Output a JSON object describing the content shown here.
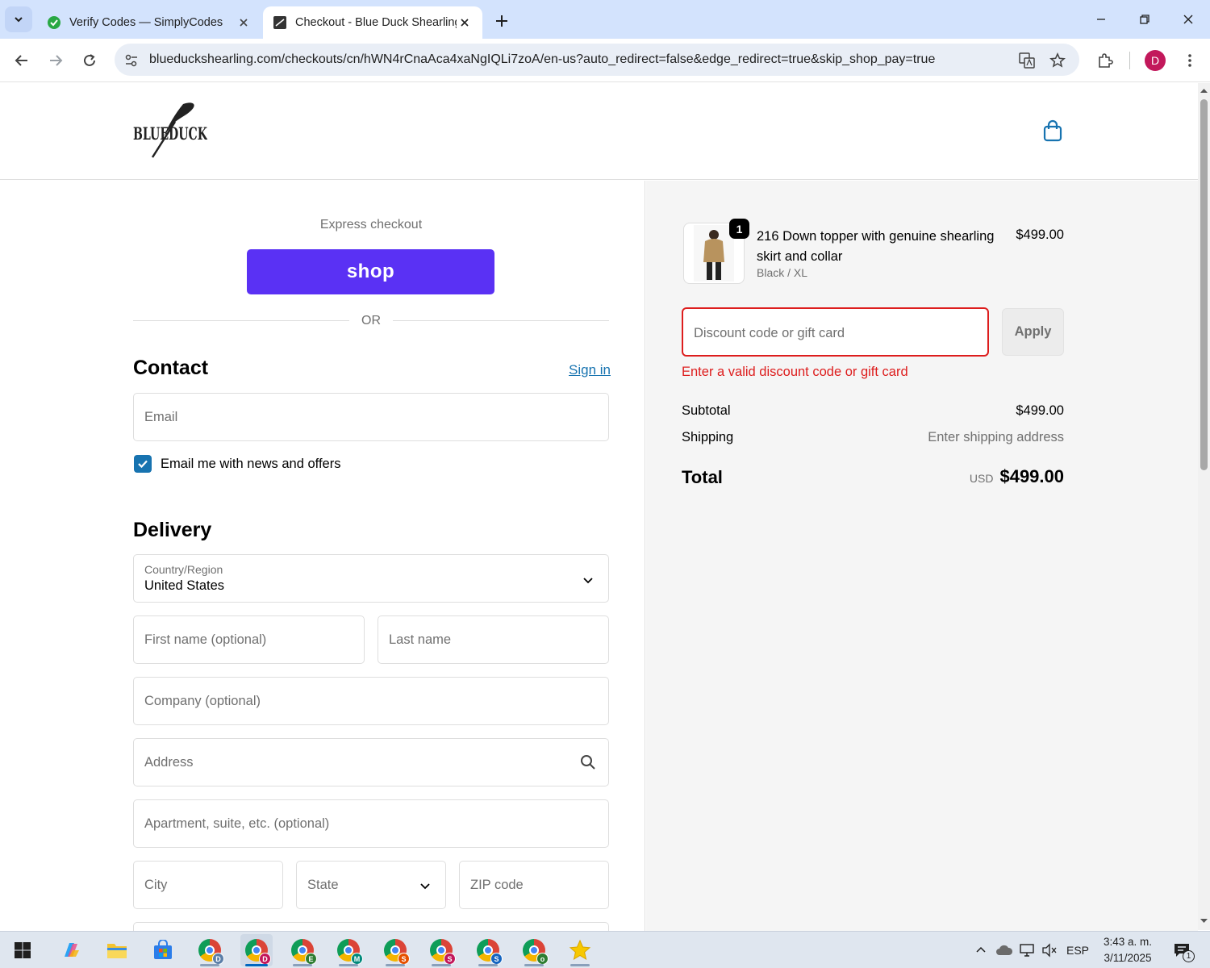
{
  "browser": {
    "tabs": [
      {
        "title": "Verify Codes — SimplyCodes",
        "active": false
      },
      {
        "title": "Checkout - Blue Duck Shearling",
        "active": true
      }
    ],
    "url": "blueduckshearling.com/checkouts/cn/hWN4rCnaAca4xaNgIQLi7zoA/en-us?auto_redirect=false&edge_redirect=true&skip_shop_pay=true",
    "profile_initial": "D"
  },
  "store": {
    "logo_text": "BLUEDUCK"
  },
  "express": {
    "label": "Express checkout",
    "shop_button": "shop",
    "or_text": "OR"
  },
  "contact": {
    "title": "Contact",
    "sign_in": "Sign in",
    "email_placeholder": "Email",
    "newsletter_label": "Email me with news and offers",
    "newsletter_checked": true
  },
  "delivery": {
    "title": "Delivery",
    "country_label": "Country/Region",
    "country_value": "United States",
    "first_name_placeholder": "First name (optional)",
    "last_name_placeholder": "Last name",
    "company_placeholder": "Company (optional)",
    "address_placeholder": "Address",
    "apartment_placeholder": "Apartment, suite, etc. (optional)",
    "city_placeholder": "City",
    "state_placeholder": "State",
    "zip_placeholder": "ZIP code"
  },
  "summary": {
    "item": {
      "quantity": "1",
      "name": "216 Down topper with genuine shearling skirt and collar",
      "variant": "Black / XL",
      "price": "$499.00"
    },
    "discount_placeholder": "Discount code or gift card",
    "apply_label": "Apply",
    "discount_error": "Enter a valid discount code or gift card",
    "subtotal_label": "Subtotal",
    "subtotal_value": "$499.00",
    "shipping_label": "Shipping",
    "shipping_value": "Enter shipping address",
    "total_label": "Total",
    "currency": "USD",
    "total_value": "$499.00"
  },
  "taskbar": {
    "apps": [
      {
        "name": "start",
        "badge": ""
      },
      {
        "name": "copilot",
        "badge": ""
      },
      {
        "name": "file-explorer",
        "badge": ""
      },
      {
        "name": "microsoft-store",
        "badge": ""
      },
      {
        "name": "chrome",
        "badge": "D",
        "color": "#5b7fa8"
      },
      {
        "name": "chrome",
        "badge": "D",
        "color": "#c2185b"
      },
      {
        "name": "chrome",
        "badge": "E",
        "color": "#2e7d32"
      },
      {
        "name": "chrome",
        "badge": "M",
        "color": "#00897b"
      },
      {
        "name": "chrome",
        "badge": "S",
        "color": "#e65100"
      },
      {
        "name": "chrome",
        "badge": "S",
        "color": "#c2185b"
      },
      {
        "name": "chrome",
        "badge": "S",
        "color": "#1565c0"
      },
      {
        "name": "chrome",
        "badge": "o",
        "color": "#2e7d32"
      },
      {
        "name": "favorites-star",
        "badge": ""
      }
    ],
    "language": "ESP",
    "time": "3:43 a. m.",
    "date": "3/11/2025",
    "notification_count": "1"
  },
  "colors": {
    "accent": "#1773b0",
    "shop_purple": "#5a31f4",
    "error": "#dd1d1d",
    "tabbar": "#d3e3fd"
  }
}
